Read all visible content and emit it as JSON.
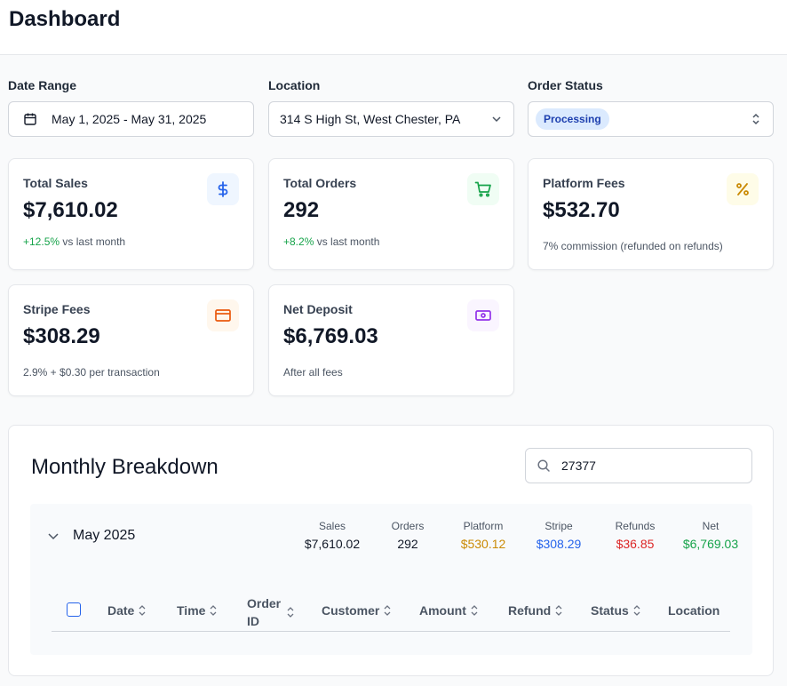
{
  "header": {
    "title": "Dashboard"
  },
  "filters": {
    "date_range": {
      "label": "Date Range",
      "value": "May 1, 2025 - May 31, 2025"
    },
    "location": {
      "label": "Location",
      "value": "314 S High St, West Chester, PA"
    },
    "order_status": {
      "label": "Order Status",
      "value": "Processing"
    }
  },
  "cards": [
    {
      "title": "Total Sales",
      "value": "$7,610.02",
      "change": "+12.5%",
      "sub": "vs last month",
      "icon": "dollar-icon",
      "accent": "#2563eb",
      "bg": "#eff6ff"
    },
    {
      "title": "Total Orders",
      "value": "292",
      "change": "+8.2%",
      "sub": "vs last month",
      "icon": "cart-icon",
      "accent": "#16a34a",
      "bg": "#f0fdf4"
    },
    {
      "title": "Platform Fees",
      "value": "$532.70",
      "sub": "7% commission (refunded on refunds)",
      "icon": "percent-icon",
      "accent": "#ca8a04",
      "bg": "#fefce8"
    },
    {
      "title": "Stripe Fees",
      "value": "$308.29",
      "sub": "2.9% + $0.30 per transaction",
      "icon": "credit-card-icon",
      "accent": "#ea580c",
      "bg": "#fff7ed"
    },
    {
      "title": "Net Deposit",
      "value": "$6,769.03",
      "sub": "After all fees",
      "icon": "banknote-icon",
      "accent": "#9333ea",
      "bg": "#faf5ff"
    }
  ],
  "breakdown": {
    "title": "Monthly Breakdown",
    "search_value": "27377",
    "month": {
      "name": "May 2025",
      "stats": [
        {
          "label": "Sales",
          "value": "$7,610.02",
          "color": "#111827"
        },
        {
          "label": "Orders",
          "value": "292",
          "color": "#111827"
        },
        {
          "label": "Platform",
          "value": "$530.12",
          "color": "#ca8a04"
        },
        {
          "label": "Stripe",
          "value": "$308.29",
          "color": "#2563eb"
        },
        {
          "label": "Refunds",
          "value": "$36.85",
          "color": "#dc2626"
        },
        {
          "label": "Net",
          "value": "$6,769.03",
          "color": "#16a34a"
        }
      ]
    },
    "columns": [
      "Date",
      "Time",
      "Order ID",
      "Customer",
      "Amount",
      "Refund",
      "Status",
      "Location"
    ]
  },
  "colors": {
    "positive": "#16a34a",
    "pill_bg": "#dbeafe",
    "pill_text": "#1e40af"
  }
}
